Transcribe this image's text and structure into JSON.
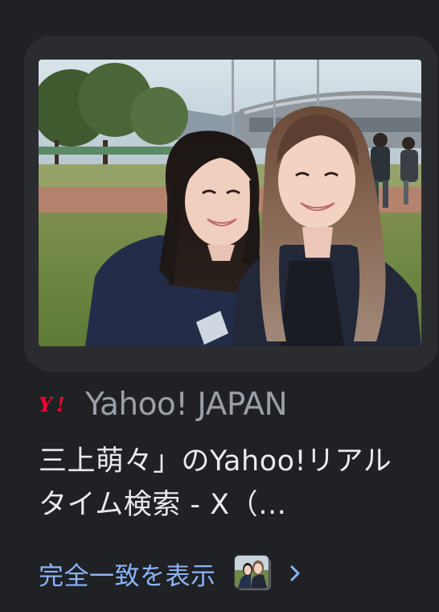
{
  "result": {
    "source": {
      "name": "Yahoo! JAPAN",
      "logo_text": "Y!"
    },
    "title": "三上萌々」のYahoo!リアルタイム検索 - X（…",
    "more_link": {
      "label": "完全一致を表示"
    }
  },
  "colors": {
    "background": "#202124",
    "card": "#2b2c2f",
    "title_text": "#e8eaed",
    "source_text": "#9aa0a6",
    "link": "#8ab4f8",
    "yahoo_red": "#ff0033"
  },
  "icons": {
    "source_logo": "yahoo-logo-icon",
    "chevron": "chevron-right-icon"
  }
}
